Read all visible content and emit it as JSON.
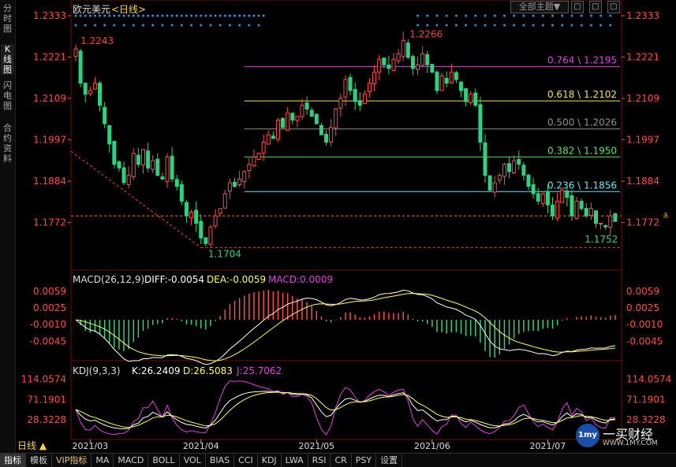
{
  "sidebar": {
    "tabs": [
      {
        "label": "分时图",
        "active": false
      },
      {
        "label": "K线图",
        "active": true
      },
      {
        "label": "闪电图",
        "active": false
      },
      {
        "label": "合约资料",
        "active": false
      }
    ]
  },
  "header": {
    "symbol": "欧元美元",
    "period": "<日线>",
    "all_themes": "全部主题▼",
    "buttons": [
      "□",
      "□",
      "▢"
    ]
  },
  "colors": {
    "up": "#ff4a4a",
    "down": "#30d080",
    "accent": "#ffd24a"
  },
  "chart_data": [
    {
      "type": "candlestick",
      "title": "",
      "y_ticks": [
        "1.2333",
        "1.2221",
        "1.2109",
        "1.1997",
        "1.1884",
        "1.1772"
      ],
      "ylim": [
        1.166,
        1.2333
      ],
      "x_labels": [
        "2021/03",
        "2021/04",
        "2021/05",
        "2021/06",
        "2021/07"
      ],
      "annotations": {
        "high": "1.2243",
        "peak": "1.2266",
        "low": "1.1704",
        "recent_low": "1.1752"
      },
      "fibonacci": [
        {
          "label": "0.764 \\ 1.2195",
          "value": 1.2195,
          "color": "#e040e0"
        },
        {
          "label": "0.618 \\ 1.2102",
          "value": 1.2102,
          "color": "#f0e060"
        },
        {
          "label": "0.500 \\ 1.2026",
          "value": 1.2026,
          "color": "#909090"
        },
        {
          "label": "0.382 \\ 1.1950",
          "value": 1.195,
          "color": "#60e060"
        },
        {
          "label": "0.236 \\ 1.1856",
          "value": 1.1856,
          "color": "#70e0f0"
        }
      ],
      "current_price": 1.179,
      "closes": [
        1.2243,
        1.215,
        1.212,
        1.213,
        1.215,
        1.209,
        1.204,
        1.1985,
        1.193,
        1.192,
        1.188,
        1.19,
        1.196,
        1.193,
        1.197,
        1.192,
        1.194,
        1.19,
        1.189,
        1.195,
        1.189,
        1.187,
        1.183,
        1.179,
        1.18,
        1.177,
        1.173,
        1.1715,
        1.176,
        1.179,
        1.181,
        1.185,
        1.188,
        1.187,
        1.189,
        1.191,
        1.193,
        1.195,
        1.196,
        1.199,
        1.201,
        1.2,
        1.205,
        1.203,
        1.207,
        1.205,
        1.206,
        1.209,
        1.208,
        1.206,
        1.204,
        1.201,
        1.199,
        1.203,
        1.208,
        1.211,
        1.216,
        1.213,
        1.21,
        1.209,
        1.212,
        1.215,
        1.218,
        1.2215,
        1.22,
        1.219,
        1.2215,
        1.223,
        1.2266,
        1.222,
        1.219,
        1.22,
        1.223,
        1.22,
        1.218,
        1.213,
        1.217,
        1.215,
        1.218,
        1.216,
        1.213,
        1.21,
        1.212,
        1.209,
        1.199,
        1.19,
        1.186,
        1.188,
        1.19,
        1.193,
        1.191,
        1.194,
        1.193,
        1.19,
        1.187,
        1.185,
        1.183,
        1.185,
        1.182,
        1.179,
        1.183,
        1.186,
        1.184,
        1.179,
        1.183,
        1.181,
        1.179,
        1.181,
        1.177,
        1.177,
        1.176,
        1.179,
        1.1775
      ],
      "series_marker_rows": 2
    },
    {
      "type": "line",
      "title": "MACD(26,12,9)",
      "values_text": {
        "diff": "DIFF:-0.0054",
        "dea": "DEA:-0.0059",
        "macd": "MACD:0.0009"
      },
      "y_ticks": [
        "0.0059",
        "0.0025",
        "-0.0010",
        "-0.0045"
      ],
      "ylim": [
        -0.0075,
        0.0072
      ]
    },
    {
      "type": "line",
      "title": "KDJ(9,3,3)",
      "values_text": {
        "k": "K:26.2409",
        "d": "D:26.5083",
        "j": "J:25.7062"
      },
      "y_ticks": [
        "114.0574",
        "71.1901",
        "28.3228"
      ],
      "ylim": [
        -5,
        120
      ]
    }
  ],
  "period_selector": "日线 ▲",
  "bottom_tabs": [
    "指标",
    "模板",
    "VIP指标",
    "MA",
    "MACD",
    "BOLL",
    "VOL",
    "BIAS",
    "CCI",
    "KDJ",
    "LWA",
    "RSI",
    "CR",
    "PSY",
    "设置"
  ],
  "logo": {
    "badge": "1my",
    "name": "一买财经",
    "url": "WWW.1MY.COM"
  }
}
